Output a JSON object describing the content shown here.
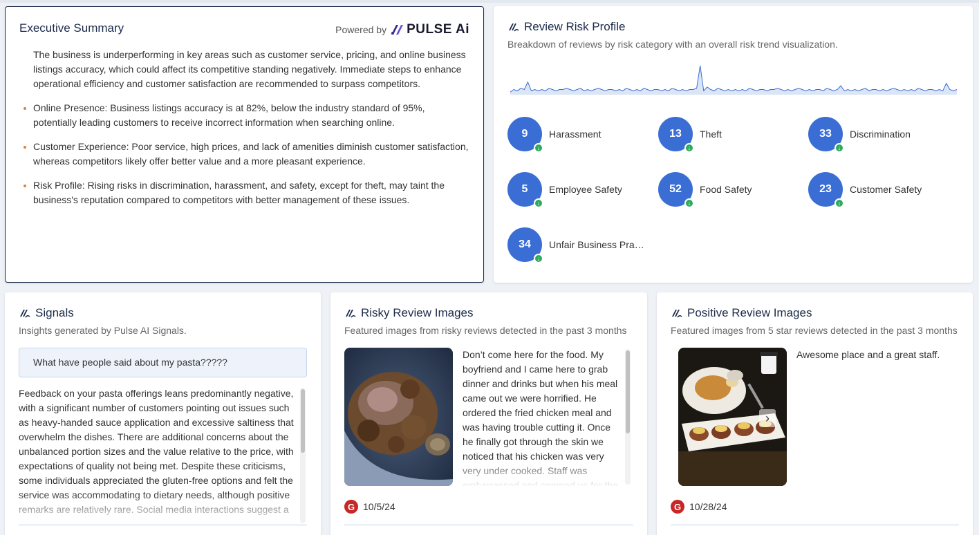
{
  "executive": {
    "title": "Executive Summary",
    "powered_by": "Powered by",
    "logo_text": "PULSE Ai",
    "intro": "The business is underperforming in key areas such as customer service, pricing, and online business listings accuracy, which could affect its competitive standing negatively. Immediate steps to enhance operational efficiency and customer satisfaction are recommended to surpass competitors.",
    "bullets": [
      "Online Presence: Business listings accuracy is at 82%, below the industry standard of 95%, potentially leading customers to receive incorrect information when searching online.",
      "Customer Experience: Poor service, high prices, and lack of amenities diminish customer satisfaction, whereas competitors likely offer better value and a more pleasant experience.",
      "Risk Profile: Rising risks in discrimination, harassment, and safety, except for theft, may taint the business's reputation compared to competitors with better management of these issues."
    ]
  },
  "risk_profile": {
    "title": "Review Risk Profile",
    "subtitle": "Breakdown of reviews by risk category with an overall risk trend visualization.",
    "trend_color": "#3a6ed4",
    "trend_values": [
      1,
      3,
      2,
      4,
      3,
      9,
      2,
      3,
      2,
      3,
      2,
      4,
      3,
      2,
      3,
      3,
      4,
      3,
      2,
      3,
      4,
      2,
      3,
      2,
      3,
      4,
      3,
      2,
      3,
      3,
      2,
      3,
      2,
      4,
      3,
      2,
      3,
      2,
      4,
      3,
      2,
      3,
      3,
      2,
      3,
      2,
      4,
      3,
      2,
      3,
      2,
      3,
      3,
      4,
      22,
      2,
      5,
      3,
      2,
      4,
      3,
      2,
      3,
      2,
      3,
      2,
      3,
      2,
      4,
      3,
      2,
      3,
      3,
      2,
      3,
      3,
      4,
      3,
      2,
      3,
      2,
      3,
      4,
      3,
      2,
      3,
      2,
      3,
      3,
      2,
      4,
      3,
      2,
      3,
      6,
      2,
      3,
      2,
      3,
      2,
      3,
      4,
      2,
      3,
      3,
      2,
      3,
      2,
      3,
      4,
      3,
      2,
      3,
      2,
      3,
      2,
      4,
      3,
      2,
      3,
      3,
      2,
      3,
      2,
      8,
      3,
      2,
      3
    ],
    "categories": [
      {
        "count": "9",
        "label": "Harassment"
      },
      {
        "count": "13",
        "label": "Theft"
      },
      {
        "count": "33",
        "label": "Discrimination"
      },
      {
        "count": "5",
        "label": "Employee Safety"
      },
      {
        "count": "52",
        "label": "Food Safety"
      },
      {
        "count": "23",
        "label": "Customer Safety"
      },
      {
        "count": "34",
        "label": "Unfair Business Pra…"
      }
    ],
    "badge_icon": "arrow-down-icon"
  },
  "signals": {
    "title": "Signals",
    "subtitle": "Insights generated by Pulse AI Signals.",
    "question": "What have people said about my pasta?????",
    "answer": "Feedback on your pasta offerings leans predominantly negative, with a significant number of customers pointing out issues such as heavy-handed sauce application and excessive saltiness that overwhelm the dishes. There are additional concerns about the unbalanced portion sizes and the value relative to the price, with expectations of quality not being met. Despite these criticisms, some individuals appreciated the gluten-free options and felt the service was accommodating to dietary needs, although positive remarks are relatively rare. Social media interactions suggest a"
  },
  "risky_images": {
    "title": "Risky Review Images",
    "subtitle": "Featured images from risky reviews detected in the past 3 months",
    "review": "Don’t come here for the food. My boyfriend and I came here to grab dinner and drinks but when his meal came out we were horrified. He ordered the fried chicken meal and was having trouble cutting it. Once he finally got through the skin we noticed that his chicken was very very under cooked. Staff was embarrassed and comped us for the",
    "source_icon": "G",
    "date": "10/5/24"
  },
  "positive_images": {
    "title": "Positive Review Images",
    "subtitle": "Featured images from 5 star reviews detected in the past 3 months",
    "review": "Awesome place and a great staff.",
    "source_icon": "G",
    "date": "10/28/24",
    "next_icon": "›"
  }
}
